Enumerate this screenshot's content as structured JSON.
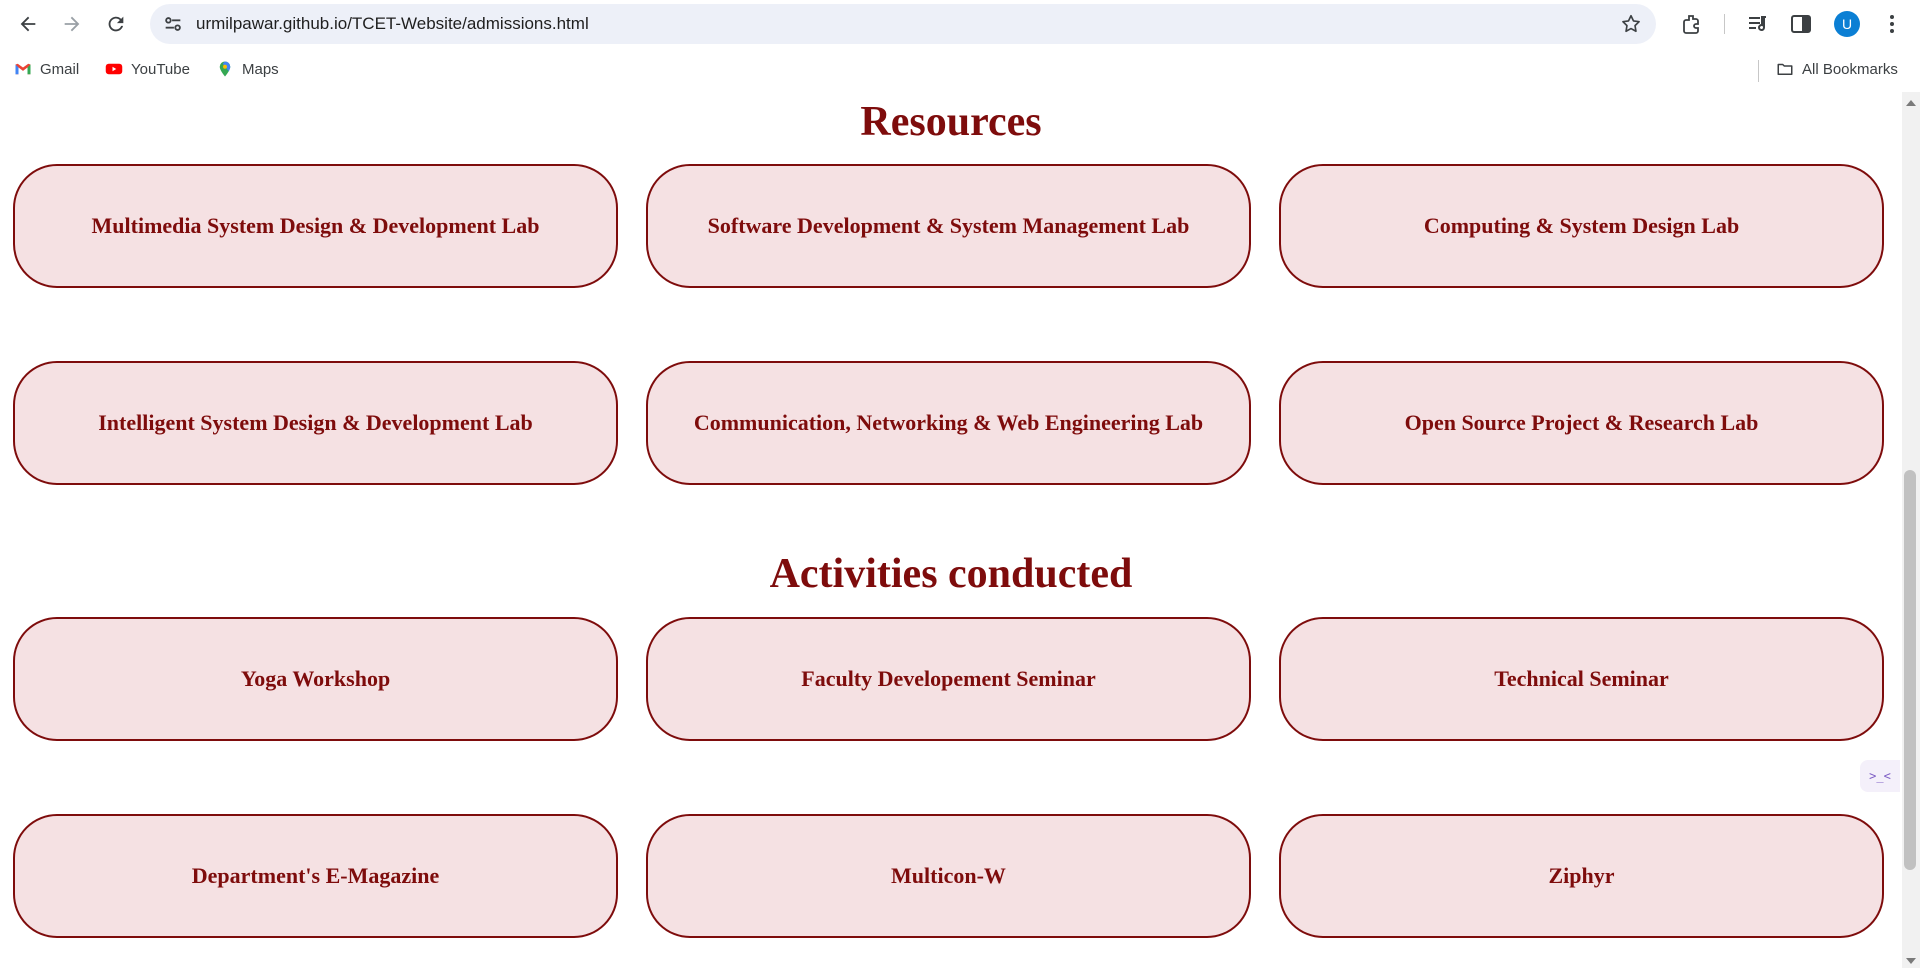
{
  "browser": {
    "url": "urmilpawar.github.io/TCET-Website/admissions.html",
    "profile_initial": "U",
    "bookmarks": [
      {
        "label": "Gmail",
        "icon": "gmail-icon"
      },
      {
        "label": "YouTube",
        "icon": "youtube-icon"
      },
      {
        "label": "Maps",
        "icon": "maps-icon"
      }
    ],
    "all_bookmarks_label": "All Bookmarks"
  },
  "page": {
    "resources": {
      "title": "Resources",
      "items": [
        "Multimedia System Design & Development Lab",
        "Software Development & System Management Lab",
        "Computing & System Design Lab",
        "Intelligent System Design & Development Lab",
        "Communication, Networking & Web Engineering Lab",
        "Open Source Project & Research Lab"
      ]
    },
    "activities": {
      "title": "Activities conducted",
      "items": [
        "Yoga Workshop",
        "Faculty Developement Seminar",
        "Technical Seminar",
        "Department's E-Magazine",
        "Multicon-W",
        "Ziphyr"
      ]
    }
  },
  "colors": {
    "accent": "#7e0c0c",
    "card_background": "#f5e1e3"
  }
}
